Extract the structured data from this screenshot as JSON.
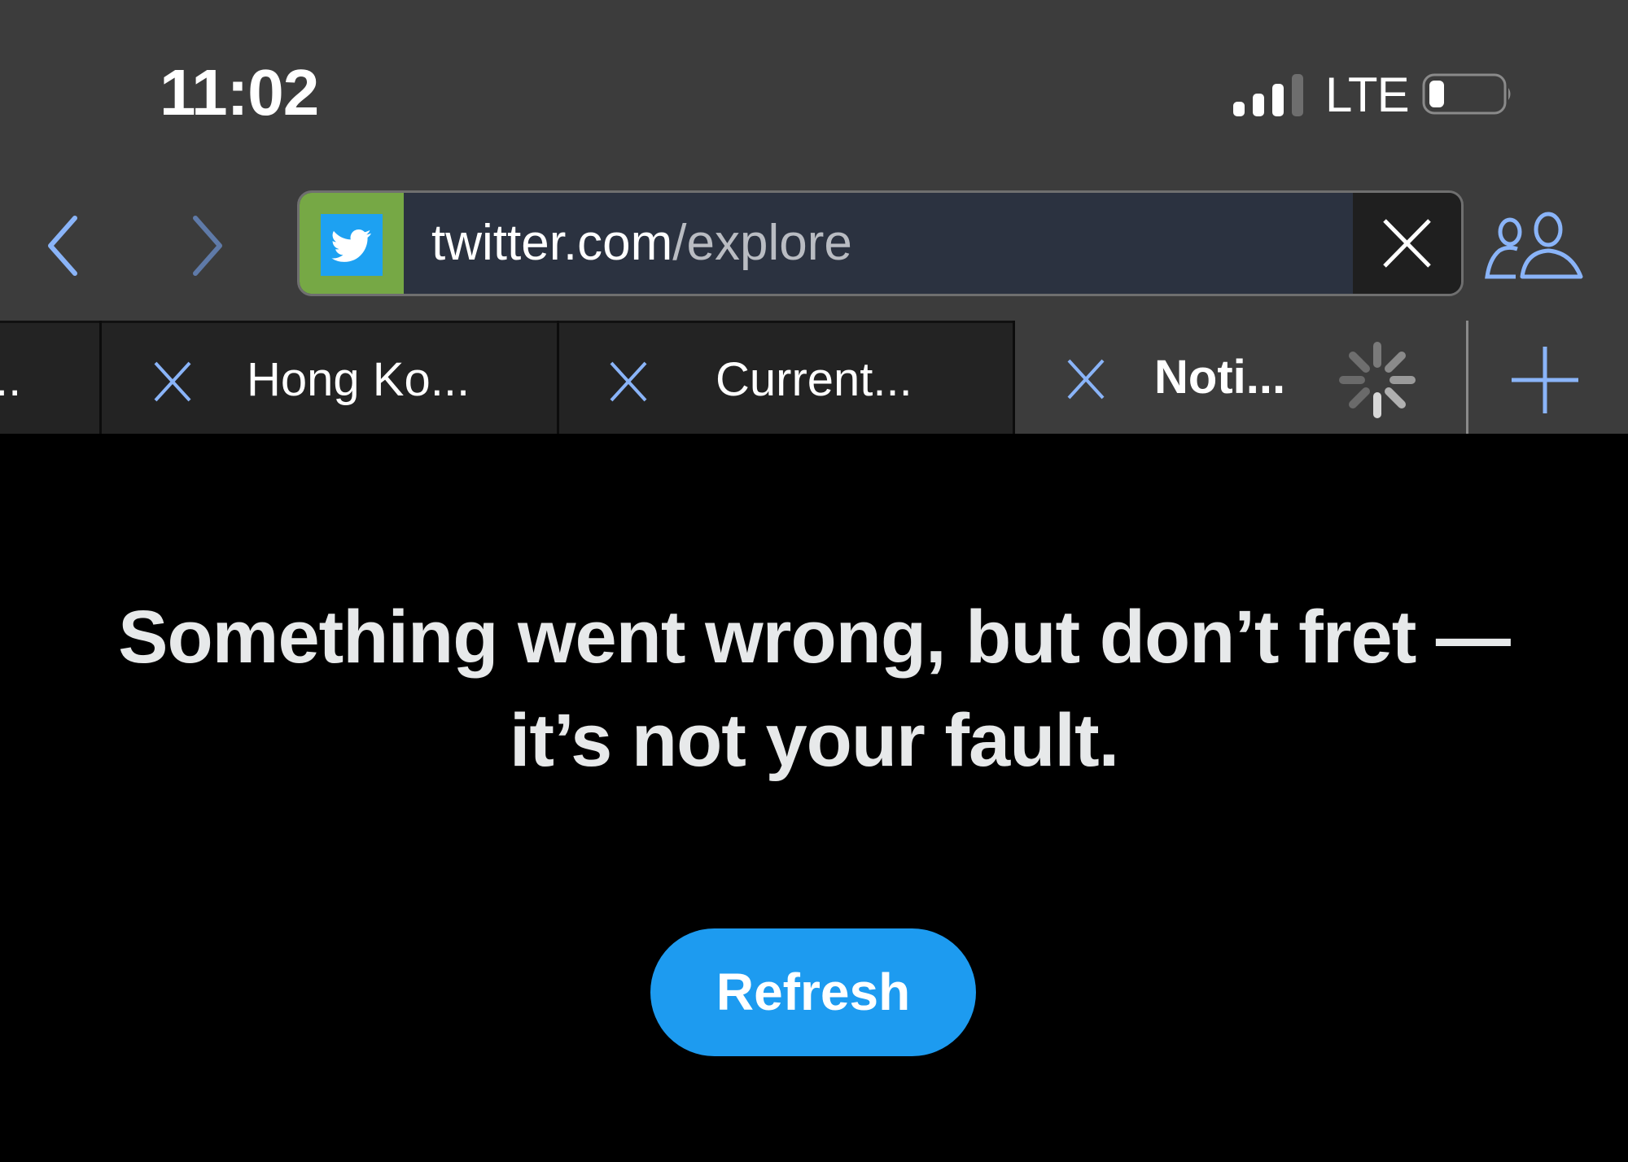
{
  "status_bar": {
    "time": "11:02",
    "network": "LTE",
    "signal_bars_active": 3,
    "signal_bars_total": 4,
    "battery_level_fraction": 0.15
  },
  "toolbar": {
    "back_icon": "chevron-left-icon",
    "forward_icon": "chevron-right-icon",
    "url": {
      "domain": "twitter.com",
      "path": "/explore",
      "favicon": "twitter-bird-icon",
      "clear_icon": "close-icon"
    },
    "people_icon": "people-icon"
  },
  "tabs": [
    {
      "label": "..",
      "active": false
    },
    {
      "label": "Hong Ko...",
      "active": false,
      "close_icon": "close-icon"
    },
    {
      "label": "Current...",
      "active": false,
      "close_icon": "close-icon"
    },
    {
      "label": "Noti...",
      "active": true,
      "close_icon": "close-icon",
      "loading": true
    }
  ],
  "new_tab_icon": "plus-icon",
  "page": {
    "error_line1": "Something went wrong, but don’t fret —",
    "error_line2": "it’s not your fault.",
    "refresh_label": "Refresh"
  },
  "colors": {
    "accent": "#8ab4f8",
    "twitter_blue": "#1d9bf0",
    "favicon_bg": "#76a845",
    "chrome_bg": "#3c3c3c",
    "inactive_tab_bg": "#232323",
    "page_bg": "#000000"
  }
}
